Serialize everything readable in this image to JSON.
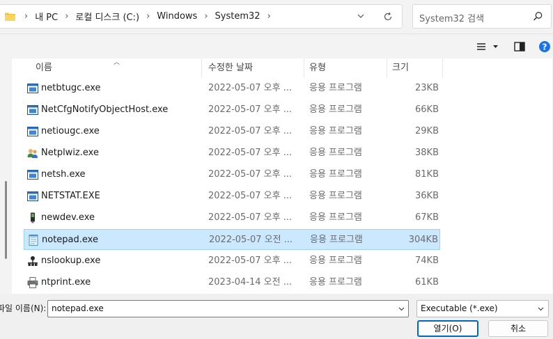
{
  "breadcrumb": [
    "내 PC",
    "로컬 디스크 (C:)",
    "Windows",
    "System32"
  ],
  "search": {
    "placeholder": "System32 검색"
  },
  "columns": {
    "name": "이름",
    "date": "수정한 날짜",
    "type": "유형",
    "size": "크기"
  },
  "files": [
    {
      "name": "netbtugc.exe",
      "date": "2022-05-07 오후 ...",
      "type": "응용 프로그램",
      "size": "23KB",
      "icon": "window-app-icon"
    },
    {
      "name": "NetCfgNotifyObjectHost.exe",
      "date": "2022-05-07 오후 ...",
      "type": "응용 프로그램",
      "size": "66KB",
      "icon": "window-app-icon"
    },
    {
      "name": "netiougc.exe",
      "date": "2022-05-07 오후 ...",
      "type": "응용 프로그램",
      "size": "29KB",
      "icon": "window-app-icon"
    },
    {
      "name": "Netplwiz.exe",
      "date": "2022-05-07 오후 ...",
      "type": "응용 프로그램",
      "size": "38KB",
      "icon": "users-icon"
    },
    {
      "name": "netsh.exe",
      "date": "2022-05-07 오후 ...",
      "type": "응용 프로그램",
      "size": "81KB",
      "icon": "window-app-icon"
    },
    {
      "name": "NETSTAT.EXE",
      "date": "2022-05-07 오후 ...",
      "type": "응용 프로그램",
      "size": "36KB",
      "icon": "window-app-icon"
    },
    {
      "name": "newdev.exe",
      "date": "2022-05-07 오후 ...",
      "type": "응용 프로그램",
      "size": "67KB",
      "icon": "device-icon"
    },
    {
      "name": "notepad.exe",
      "date": "2022-05-07 오전 ...",
      "type": "응용 프로그램",
      "size": "304KB",
      "icon": "notepad-icon",
      "selected": true
    },
    {
      "name": "nslookup.exe",
      "date": "2022-05-07 오후 ...",
      "type": "응용 프로그램",
      "size": "74KB",
      "icon": "network-icon"
    },
    {
      "name": "ntprint.exe",
      "date": "2023-04-14 오전 ...",
      "type": "응용 프로그램",
      "size": "61KB",
      "icon": "printer-icon"
    }
  ],
  "filename": {
    "label": "파일 이름(N):",
    "value": "notepad.exe"
  },
  "filetype": {
    "value": "Executable (*.exe)"
  },
  "buttons": {
    "open": "열기(O)",
    "cancel": "취소"
  },
  "colors": {
    "selection": "#cce8ff",
    "selection_border": "#99d1ff",
    "accent": "#0067c0"
  }
}
